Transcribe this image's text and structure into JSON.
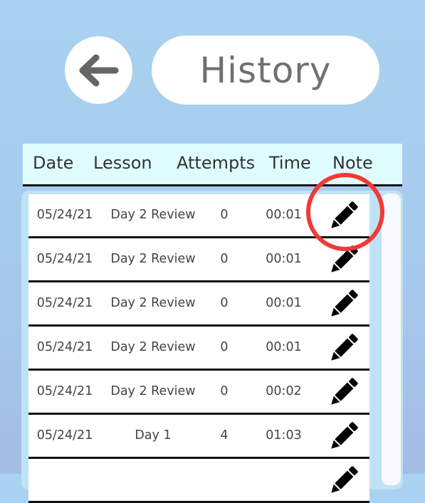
{
  "header": {
    "back_icon": "arrow-left-icon",
    "title": "History"
  },
  "table": {
    "columns": [
      "Date",
      "Lesson",
      "Attempts",
      "Time",
      "Note"
    ],
    "note_icon": "pencil-icon",
    "rows": [
      {
        "date": "05/24/21",
        "lesson": "Day 2 Review",
        "attempts": "0",
        "time": "00:01"
      },
      {
        "date": "05/24/21",
        "lesson": "Day 2 Review",
        "attempts": "0",
        "time": "00:01"
      },
      {
        "date": "05/24/21",
        "lesson": "Day 2 Review",
        "attempts": "0",
        "time": "00:01"
      },
      {
        "date": "05/24/21",
        "lesson": "Day 2 Review",
        "attempts": "0",
        "time": "00:01"
      },
      {
        "date": "05/24/21",
        "lesson": "Day 2 Review",
        "attempts": "0",
        "time": "00:02"
      },
      {
        "date": "05/24/21",
        "lesson": "Day 1",
        "attempts": "4",
        "time": "01:03"
      }
    ]
  },
  "colors": {
    "highlight": "#ef3a36",
    "header_bg": "#dffdff",
    "background": "#a6c9ec"
  }
}
